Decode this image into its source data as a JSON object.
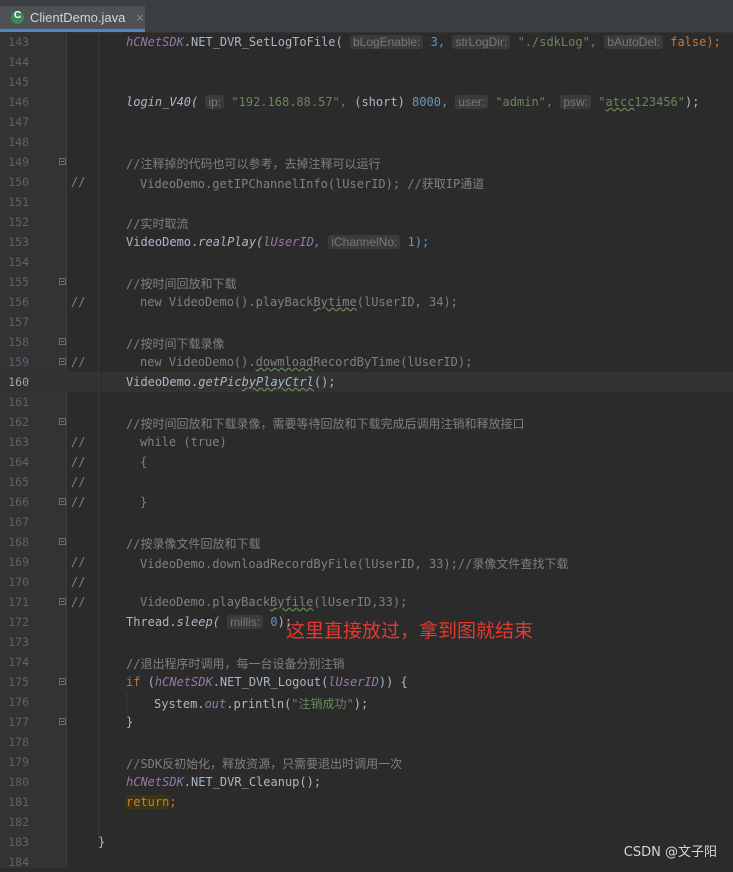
{
  "tab": {
    "title": "ClientDemo.java",
    "close": "×"
  },
  "lines": [
    {
      "n": "143"
    },
    {
      "n": "144"
    },
    {
      "n": "145"
    },
    {
      "n": "146"
    },
    {
      "n": "147"
    },
    {
      "n": "148"
    },
    {
      "n": "149"
    },
    {
      "n": "150",
      "cm": "//"
    },
    {
      "n": "151"
    },
    {
      "n": "152"
    },
    {
      "n": "153"
    },
    {
      "n": "154"
    },
    {
      "n": "155"
    },
    {
      "n": "156",
      "cm": "//"
    },
    {
      "n": "157"
    },
    {
      "n": "158"
    },
    {
      "n": "159",
      "cm": "//"
    },
    {
      "n": "160"
    },
    {
      "n": "161"
    },
    {
      "n": "162"
    },
    {
      "n": "163",
      "cm": "//"
    },
    {
      "n": "164",
      "cm": "//"
    },
    {
      "n": "165",
      "cm": "//"
    },
    {
      "n": "166",
      "cm": "//"
    },
    {
      "n": "167"
    },
    {
      "n": "168"
    },
    {
      "n": "169",
      "cm": "//"
    },
    {
      "n": "170",
      "cm": "//"
    },
    {
      "n": "171",
      "cm": "//"
    },
    {
      "n": "172"
    },
    {
      "n": "173"
    },
    {
      "n": "174"
    },
    {
      "n": "175"
    },
    {
      "n": "176"
    },
    {
      "n": "177"
    },
    {
      "n": "178"
    },
    {
      "n": "179"
    },
    {
      "n": "180"
    },
    {
      "n": "181"
    },
    {
      "n": "182"
    },
    {
      "n": "183"
    },
    {
      "n": "184"
    }
  ],
  "code": {
    "l143": {
      "obj": "hCNetSDK",
      "call": ".NET_DVR_SetLogToFile(",
      "h1": "bLogEnable:",
      "v1": "3,",
      "h2": "strLogDir:",
      "v2": "\"./sdkLog\",",
      "h3": "bAutoDel:",
      "v3": "false);"
    },
    "l146": {
      "call": "login_V40(",
      "h1": "ip:",
      "v1": "\"192.168.88.57\",",
      "cast": "(short)",
      "v2": "8000,",
      "h2": "user:",
      "v3": "\"admin\",",
      "h3": "psw:",
      "v4a": "\"",
      "v4b": "atcc",
      "v4c": "123456\"",
      "end": ");"
    },
    "l149": "//注释掉的代码也可以参考，去掉注释可以运行",
    "l150": "VideoDemo.getIPChannelInfo(lUserID); //获取IP通道",
    "l152": "//实时取流",
    "l153": {
      "a": "VideoDemo.",
      "b": "realPlay(",
      "c": "lUserID,",
      "h": "iChannelNo:",
      "d": "1);"
    },
    "l155": "//按时间回放和下载",
    "l156a": "new VideoDemo().playBack",
    "l156b": "Bytime",
    "l156c": "(lUserID, 34);",
    "l158": "//按时间下载录像",
    "l159a": "new VideoDemo().",
    "l159b": "dowmload",
    "l159c": "RecordByTime(lUserID);",
    "l160": {
      "a": "VideoDemo.",
      "b": "getPic",
      "c": "byPlayCtrl",
      "d": "();"
    },
    "l162": "//按时间回放和下载录像，需要等待回放和下载完成后调用注销和释放接口",
    "l163": "while (true)",
    "l164": "{",
    "l166": "}",
    "l168": "//按录像文件回放和下载",
    "l169": "VideoDemo.downloadRecordByFile(lUserID, 33);//录像文件查找下载",
    "l171a": "VideoDemo.playBack",
    "l171b": "Byfile",
    "l171c": "(lUserID,33);",
    "l172": {
      "a": "Thread.",
      "b": "sleep(",
      "h": "millis:",
      "v": "0",
      "end": ");"
    },
    "annotation": "这里直接放过，拿到图就结束",
    "l174": "//退出程序时调用，每一台设备分别注销",
    "l175": {
      "kw": "if",
      "a": " (",
      "obj": "hCNetSDK",
      "b": ".NET_DVR_Logout(",
      "c": "lUserID",
      "d": ")) {"
    },
    "l176": {
      "a": "System.",
      "b": "out",
      "c": ".println(",
      "s": "\"注销成功\"",
      "d": ");"
    },
    "l177": "}",
    "l179": "//SDK反初始化，释放资源，只需要退出时调用一次",
    "l180": {
      "obj": "hCNetSDK",
      "b": ".NET_DVR_Cleanup();"
    },
    "l181": {
      "kw": "return",
      "end": ";"
    },
    "l183": "}"
  },
  "watermark": "CSDN @文子阳"
}
